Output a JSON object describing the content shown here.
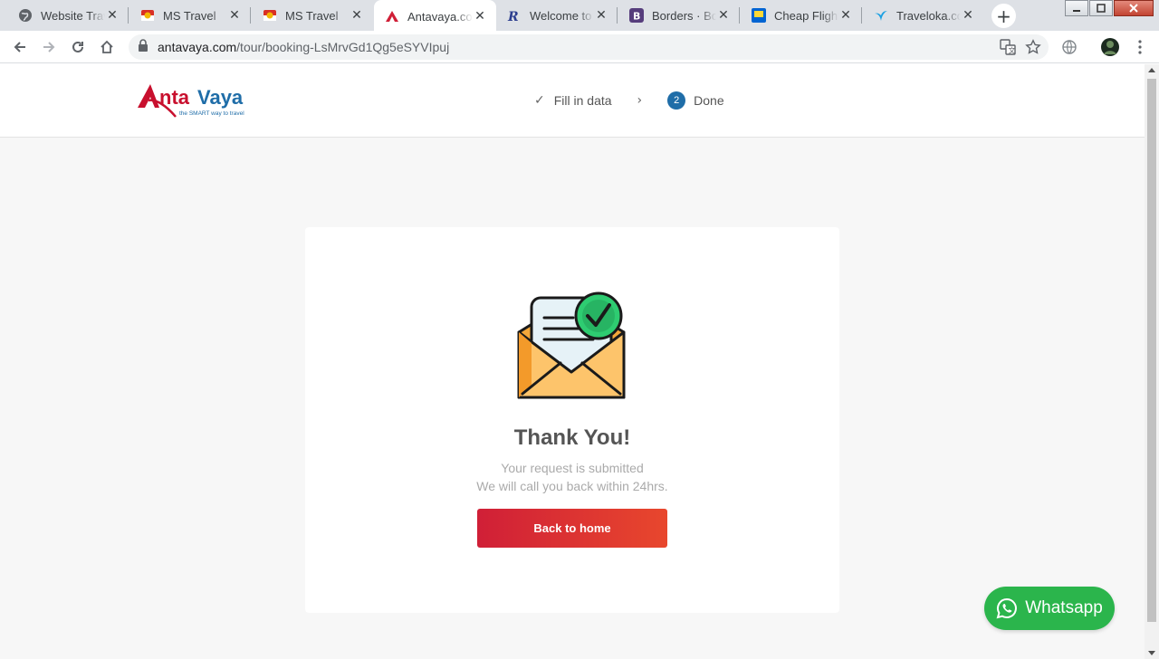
{
  "browser": {
    "tabs": [
      {
        "title": "Website Travel",
        "favicon": "globe-icon"
      },
      {
        "title": "MS Travel",
        "favicon": "ms-travel-icon"
      },
      {
        "title": "MS Travel",
        "favicon": "ms-travel-icon"
      },
      {
        "title": "Antavaya.com",
        "favicon": "antavaya-icon",
        "active": true
      },
      {
        "title": "Welcome to R",
        "favicon": "r-icon"
      },
      {
        "title": "Borders · Boo",
        "favicon": "bootstrap-icon"
      },
      {
        "title": "Cheap Flights",
        "favicon": "tiket-icon"
      },
      {
        "title": "Traveloka.com",
        "favicon": "traveloka-icon"
      }
    ],
    "new_tab_symbol": "+",
    "close_symbol": "✕",
    "url_host": "antavaya.com",
    "url_path": "/tour/booking-LsMrvGd1Qg5eSYVIpuj"
  },
  "header": {
    "brand_prefix": "A",
    "brand_mid": "nta",
    "brand_suffix": "Vaya",
    "tagline": "the SMART way to travel",
    "steps": [
      {
        "label": "Fill in data",
        "state": "done"
      },
      {
        "number": "2",
        "label": "Done",
        "state": "current"
      }
    ]
  },
  "card": {
    "title": "Thank You!",
    "line1": "Your request is submitted",
    "line2": "We will call you back within 24hrs.",
    "button": "Back to home"
  },
  "whatsapp": {
    "label": "Whatsapp"
  },
  "colors": {
    "brand_red": "#d01f37",
    "brand_blue": "#1f6da8",
    "whatsapp_green": "#2bb54c"
  }
}
